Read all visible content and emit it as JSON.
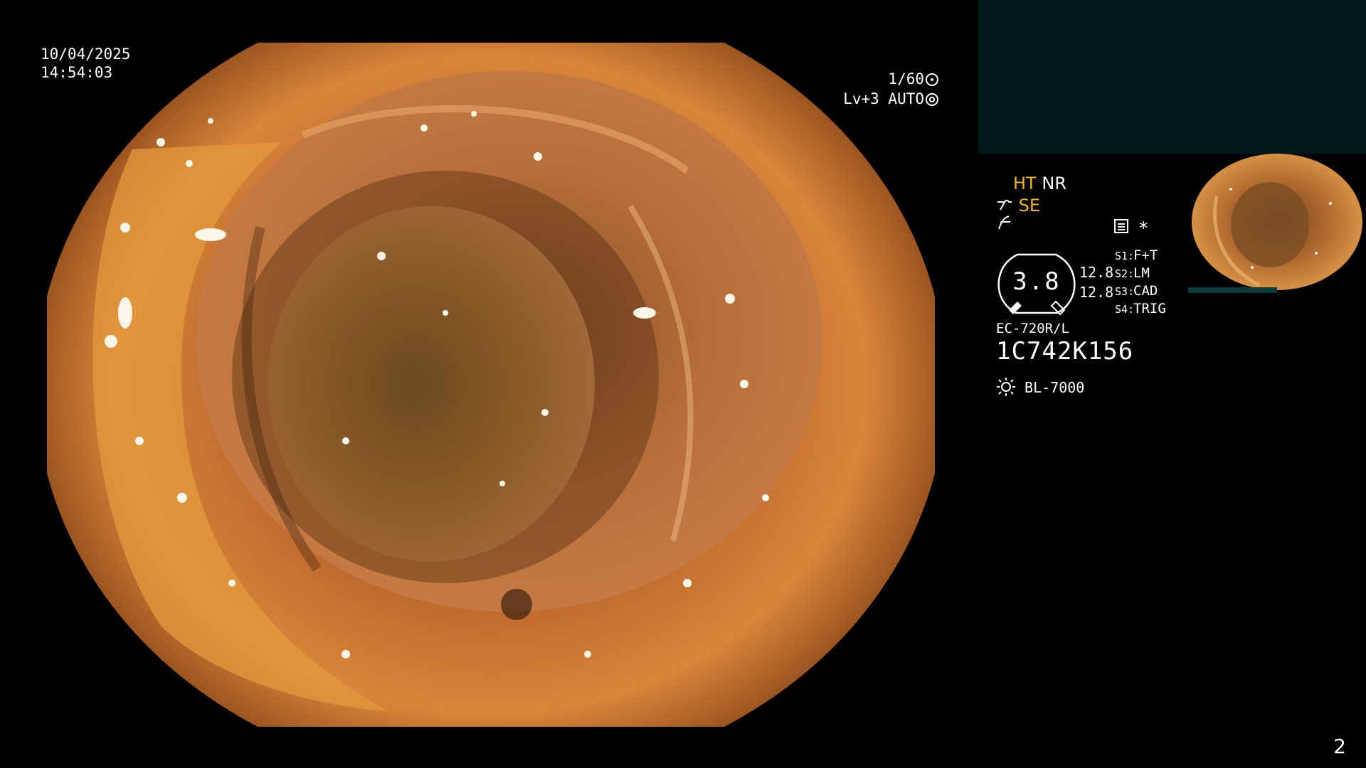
{
  "overlay": {
    "date": "10/04/2025",
    "time": "14:54:03",
    "shutter": "1/60",
    "shutter_icon": "shutter-icon",
    "exposure_level": "Lv+3",
    "exposure_mode": "AUTO",
    "exposure_icon": "iris-icon"
  },
  "status": {
    "ht": "HT",
    "nr": "NR",
    "se": "SE",
    "se_icon": "structure-enhance-icon",
    "tail_icon": "frequency-icon",
    "memo_icon": "memo-icon",
    "asterisk": "*"
  },
  "dial": {
    "value": "3.8",
    "left_value_1": "12.8",
    "left_value_2": "12.8"
  },
  "modes": [
    {
      "key": "S1:",
      "label": "F+T"
    },
    {
      "key": "S2:",
      "label": "LM"
    },
    {
      "key": "S3:",
      "label": "CAD"
    },
    {
      "key": "S4:",
      "label": "TRIG"
    }
  ],
  "scope": {
    "model": "EC-720R/L",
    "serial": "1C742K156",
    "lamp_icon": "light-source-icon",
    "lamp": "BL-7000"
  },
  "page_number": "2",
  "colors": {
    "preview_panel": "#021818",
    "accent_yellow": "#f3b617",
    "mucosa": "#c86a24"
  }
}
